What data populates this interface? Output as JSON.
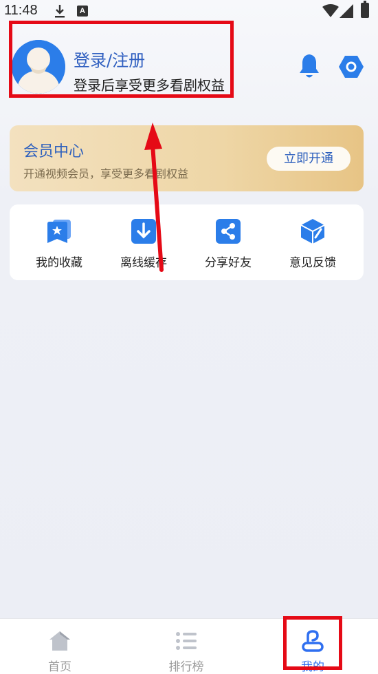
{
  "status_bar": {
    "time": "11:48"
  },
  "profile": {
    "title": "登录/注册",
    "subtitle": "登录后享受更多看剧权益"
  },
  "header_icons": [
    "bell-icon",
    "settings-icon"
  ],
  "vip": {
    "title": "会员中心",
    "subtitle": "开通视频会员，享受更多看剧权益",
    "button": "立即开通"
  },
  "actions": [
    {
      "label": "我的收藏",
      "icon": "favorites-icon"
    },
    {
      "label": "离线缓存",
      "icon": "download-icon"
    },
    {
      "label": "分享好友",
      "icon": "share-icon"
    },
    {
      "label": "意见反馈",
      "icon": "feedback-icon"
    }
  ],
  "bottom_nav": [
    {
      "label": "首页",
      "icon": "home-icon",
      "active": false
    },
    {
      "label": "排行榜",
      "icon": "ranking-icon",
      "active": false
    },
    {
      "label": "我的",
      "icon": "profile-icon",
      "active": true
    }
  ],
  "colors": {
    "accent": "#2f6ff0",
    "annotation_red": "#e50a16",
    "vip_gold": "#eed6a6"
  }
}
